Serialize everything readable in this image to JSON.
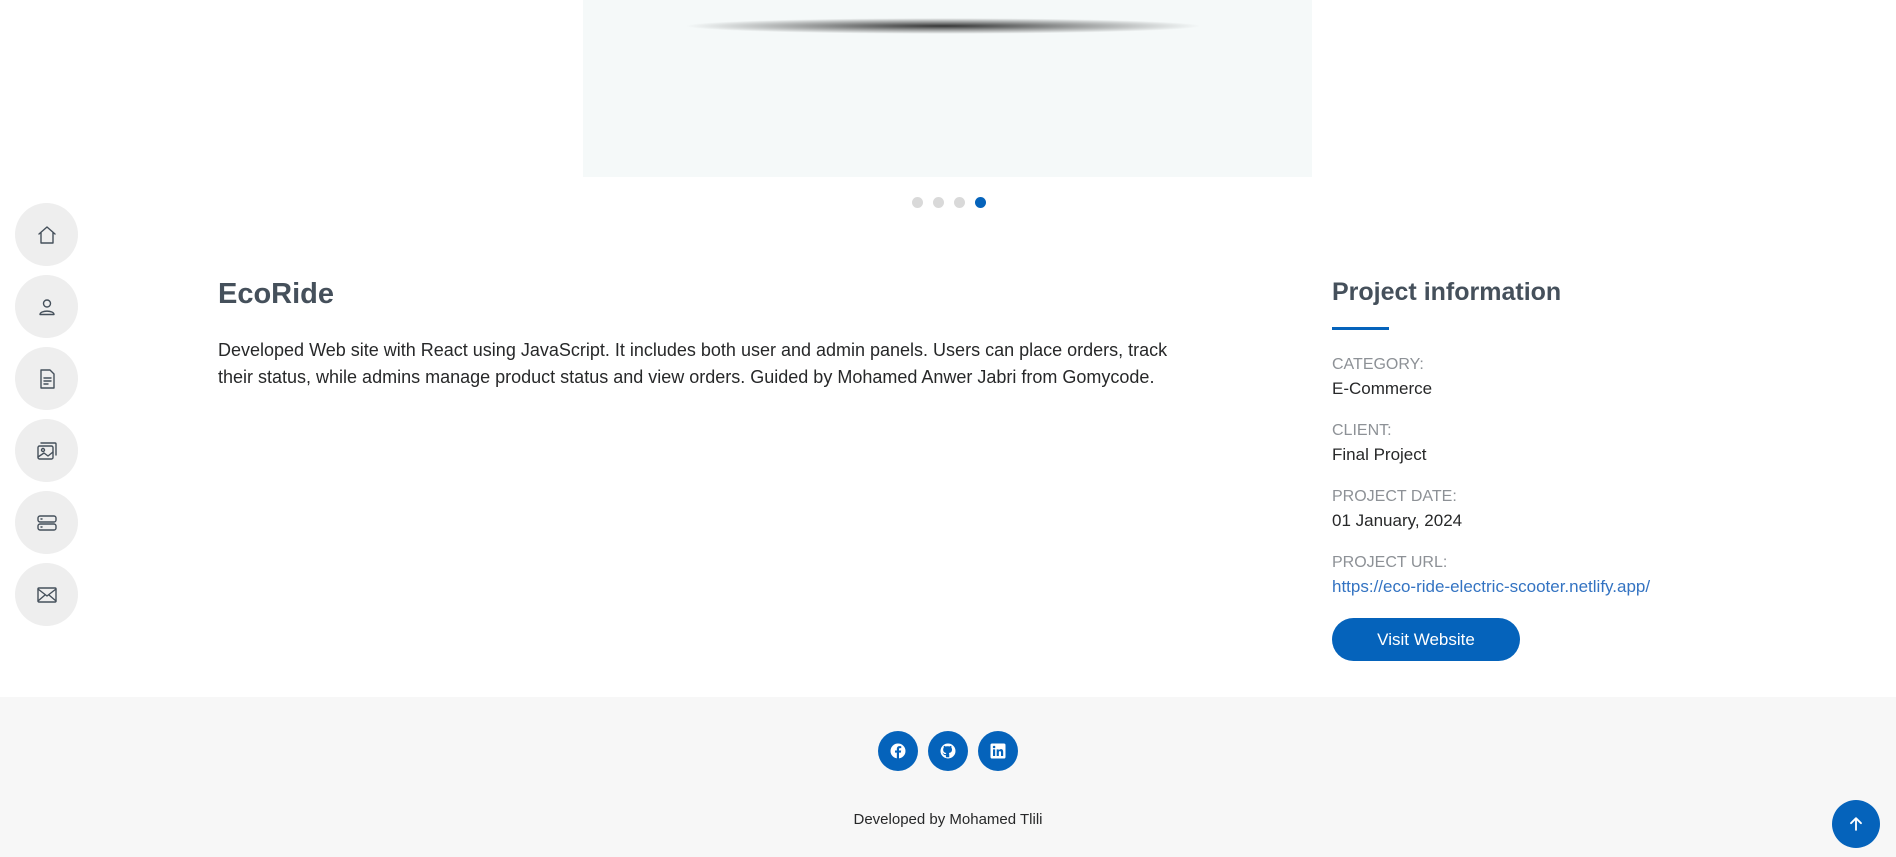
{
  "carousel": {
    "slides_total": 4,
    "active_slide": 4
  },
  "sidebar": {
    "items": [
      {
        "icon": "home-icon"
      },
      {
        "icon": "person-icon"
      },
      {
        "icon": "file-text-icon"
      },
      {
        "icon": "images-icon"
      },
      {
        "icon": "server-icon"
      },
      {
        "icon": "envelope-icon"
      }
    ]
  },
  "project": {
    "title": "EcoRide",
    "description": "Developed Web site with React using JavaScript. It includes both user and admin panels. Users can place orders, track their status, while admins manage product status and view orders. Guided by Mohamed Anwer Jabri from Gomycode."
  },
  "info": {
    "heading": "Project information",
    "category_label": "CATEGORY:",
    "category_value": "E-Commerce",
    "client_label": "CLIENT:",
    "client_value": "Final Project",
    "date_label": "PROJECT DATE:",
    "date_value": "01 January, 2024",
    "url_label": "PROJECT URL:",
    "url_value": "https://eco-ride-electric-scooter.netlify.app/",
    "visit_button": "Visit Website"
  },
  "footer": {
    "social": [
      "facebook-icon",
      "github-icon",
      "linkedin-icon"
    ],
    "credit": "Developed by Mohamed Tlili"
  },
  "colors": {
    "accent": "#0563bb",
    "heading": "#45505b",
    "footer_bg": "#f7f7f7"
  }
}
